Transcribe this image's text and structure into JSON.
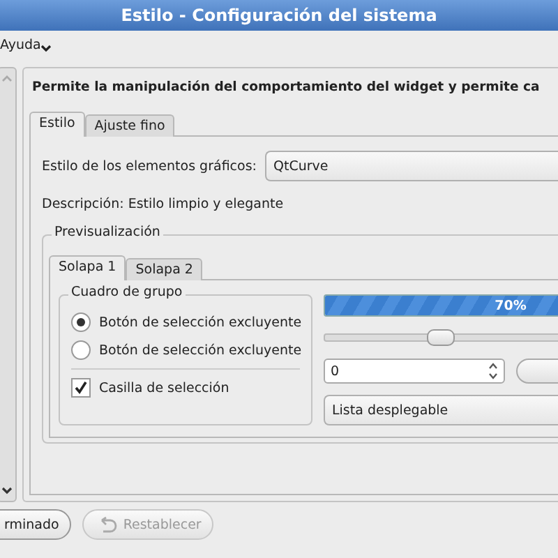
{
  "window": {
    "title": "Estilo - Configuración del sistema"
  },
  "menu": {
    "label": "Ayuda"
  },
  "header": "Permite la manipulación del comportamiento del widget y permite ca",
  "tabs": [
    {
      "label": "Estilo",
      "selected": true
    },
    {
      "label": "Ajuste fino",
      "selected": false
    }
  ],
  "style_field": {
    "label": "Estilo de los elementos gráficos:",
    "value": "QtCurve"
  },
  "description": "Descripción: Estilo limpio y elegante",
  "preview": {
    "title": "Previsualización",
    "tabs": [
      {
        "label": "Solapa 1",
        "selected": true
      },
      {
        "label": "Solapa 2",
        "selected": false
      }
    ],
    "group": {
      "title": "Cuadro de grupo",
      "options": [
        {
          "label": "Botón de selección excluyente",
          "selected": true
        },
        {
          "label": "Botón de selección excluyente",
          "selected": false
        }
      ],
      "checkbox": {
        "label": "Casilla de selección",
        "checked": true
      }
    },
    "progress": {
      "level": 0.7,
      "reading": "70%"
    },
    "slider": {
      "level": 0.31
    },
    "spinbox": {
      "value": "0"
    },
    "combo": {
      "value": "Lista desplegable"
    }
  },
  "buttons": [
    {
      "label": "rminado",
      "disabled": false
    },
    {
      "label": "Restablecer",
      "disabled": true
    }
  ]
}
